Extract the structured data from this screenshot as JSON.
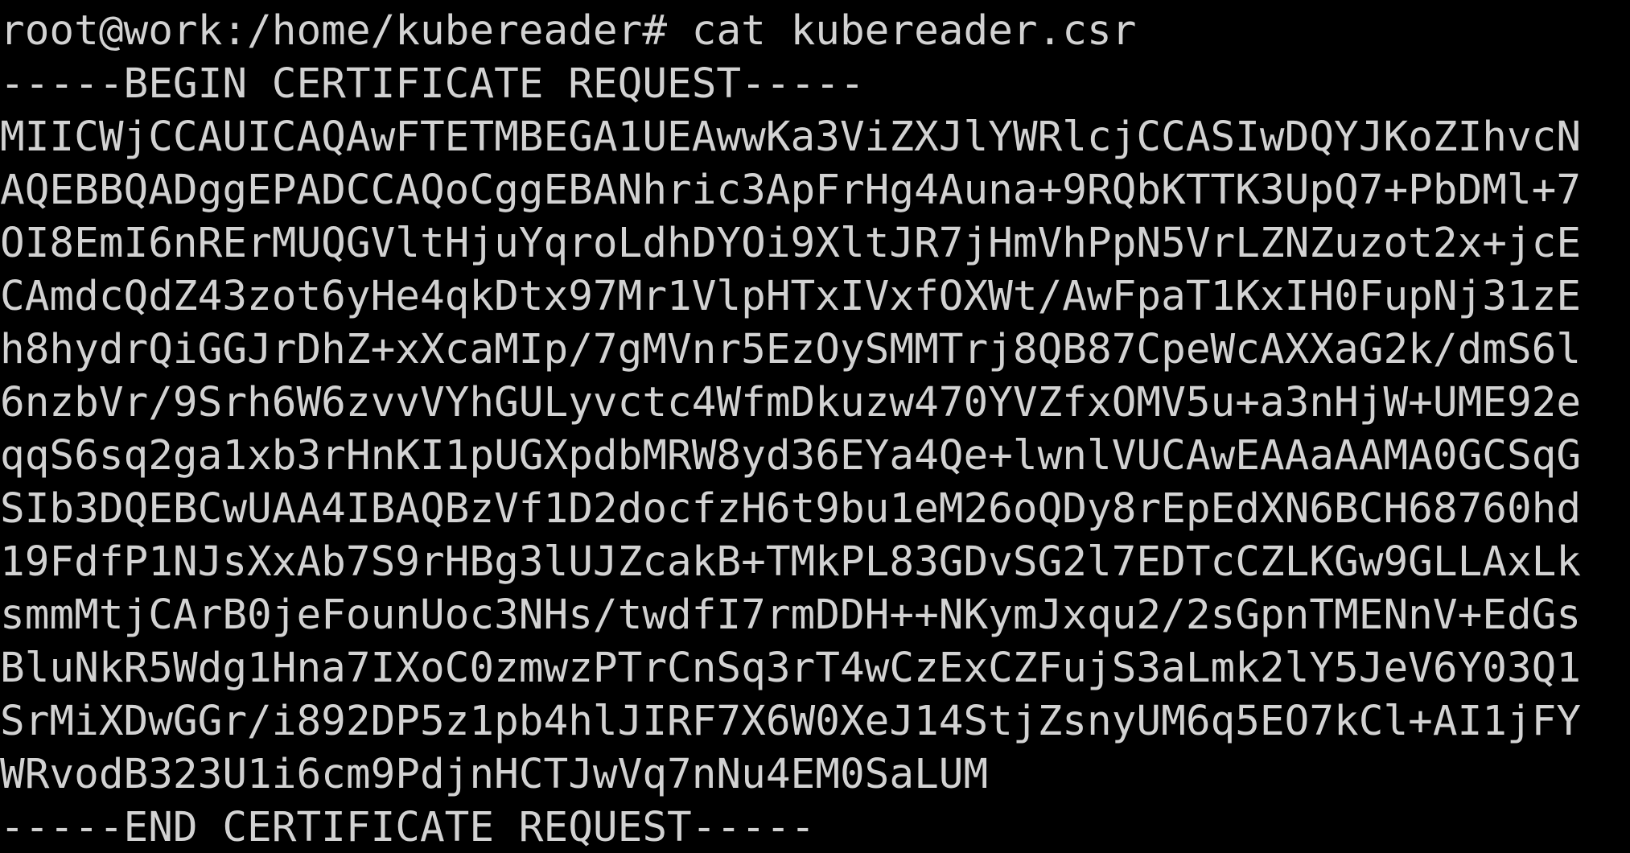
{
  "terminal": {
    "prompt": "root@work:/home/kubereader#",
    "command": "cat kubereader.csr",
    "output_lines": [
      "-----BEGIN CERTIFICATE REQUEST-----",
      "MIICWjCCAUICAQAwFTETMBEGA1UEAwwKa3ViZXJlYWRlcjCCASIwDQYJKoZIhvcN",
      "AQEBBQADggEPADCCAQoCggEBANhric3ApFrHg4Auna+9RQbKTTK3UpQ7+PbDMl+7",
      "OI8EmI6nRErMUQGVltHjuYqroLdhDYOi9XltJR7jHmVhPpN5VrLZNZuzot2x+jcE",
      "CAmdcQdZ43zot6yHe4qkDtx97Mr1VlpHTxIVxfOXWt/AwFpaT1KxIH0FupNj31zE",
      "h8hydrQiGGJrDhZ+xXcaMIp/7gMVnr5EzOySMMTrj8QB87CpeWcAXXaG2k/dmS6l",
      "6nzbVr/9Srh6W6zvvVYhGULyvctc4WfmDkuzw470YVZfxOMV5u+a3nHjW+UME92e",
      "qqS6sq2ga1xb3rHnKI1pUGXpdbMRW8yd36EYa4Qe+lwnlVUCAwEAAaAAMA0GCSqG",
      "SIb3DQEBCwUAA4IBAQBzVf1D2docfzH6t9bu1eM26oQDy8rEpEdXN6BCH68760hd",
      "19FdfP1NJsXxAb7S9rHBg3lUJZcakB+TMkPL83GDvSG2l7EDTcCZLKGw9GLLAxLk",
      "smmMtjCArB0jeFounUoc3NHs/twdfI7rmDDH++NKymJxqu2/2sGpnTMENnV+EdGs",
      "BluNkR5Wdg1Hna7IXoC0zmwzPTrCnSq3rT4wCzExCZFujS3aLmk2lY5JeV6Y03Q1",
      "SrMiXDwGGr/i892DP5z1pb4hlJIRF7X6W0XeJ14StjZsnyUM6q5EO7kCl+AI1jFY",
      "WRvodB323U1i6cm9PdjnHCTJwVq7nNu4EM0SaLUM",
      "-----END CERTIFICATE REQUEST-----"
    ]
  },
  "colors": {
    "background": "#000000",
    "foreground": "#d2d2d2"
  }
}
